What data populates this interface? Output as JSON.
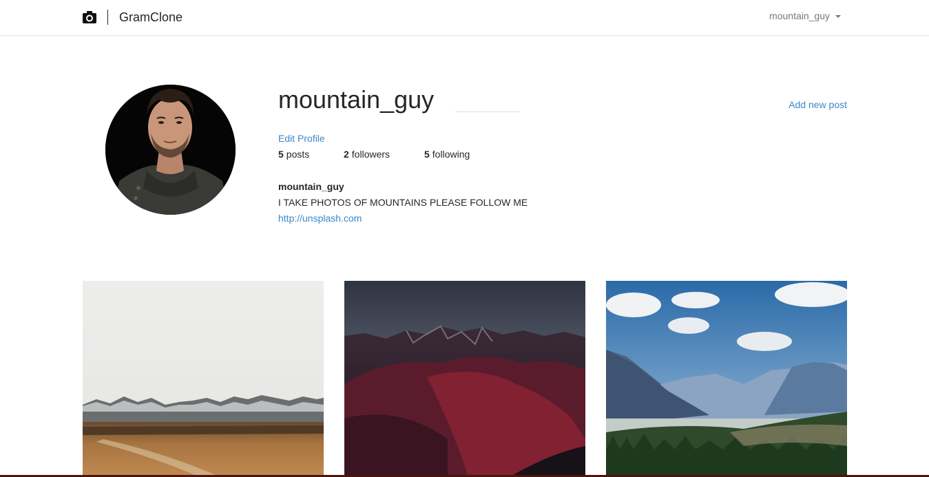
{
  "nav": {
    "brand": "GramClone",
    "user": "mountain_guy"
  },
  "profile": {
    "username": "mountain_guy",
    "add_post": "Add new post",
    "edit_profile": "Edit Profile",
    "stats": [
      {
        "count": "5",
        "label": "posts"
      },
      {
        "count": "2",
        "label": "followers"
      },
      {
        "count": "5",
        "label": "following"
      }
    ],
    "bio_name": "mountain_guy",
    "bio": "I TAKE PHOTOS OF MOUNTAINS PLEASE FOLLOW ME",
    "website": "http://unsplash.com"
  },
  "posts": [
    {
      "icon": "misty-mountain-plain-photo"
    },
    {
      "icon": "red-mountain-range-photo"
    },
    {
      "icon": "blue-sky-valley-photo"
    }
  ],
  "colors": {
    "link": "#3b87c8",
    "text": "#262626",
    "muted": "#777777"
  }
}
